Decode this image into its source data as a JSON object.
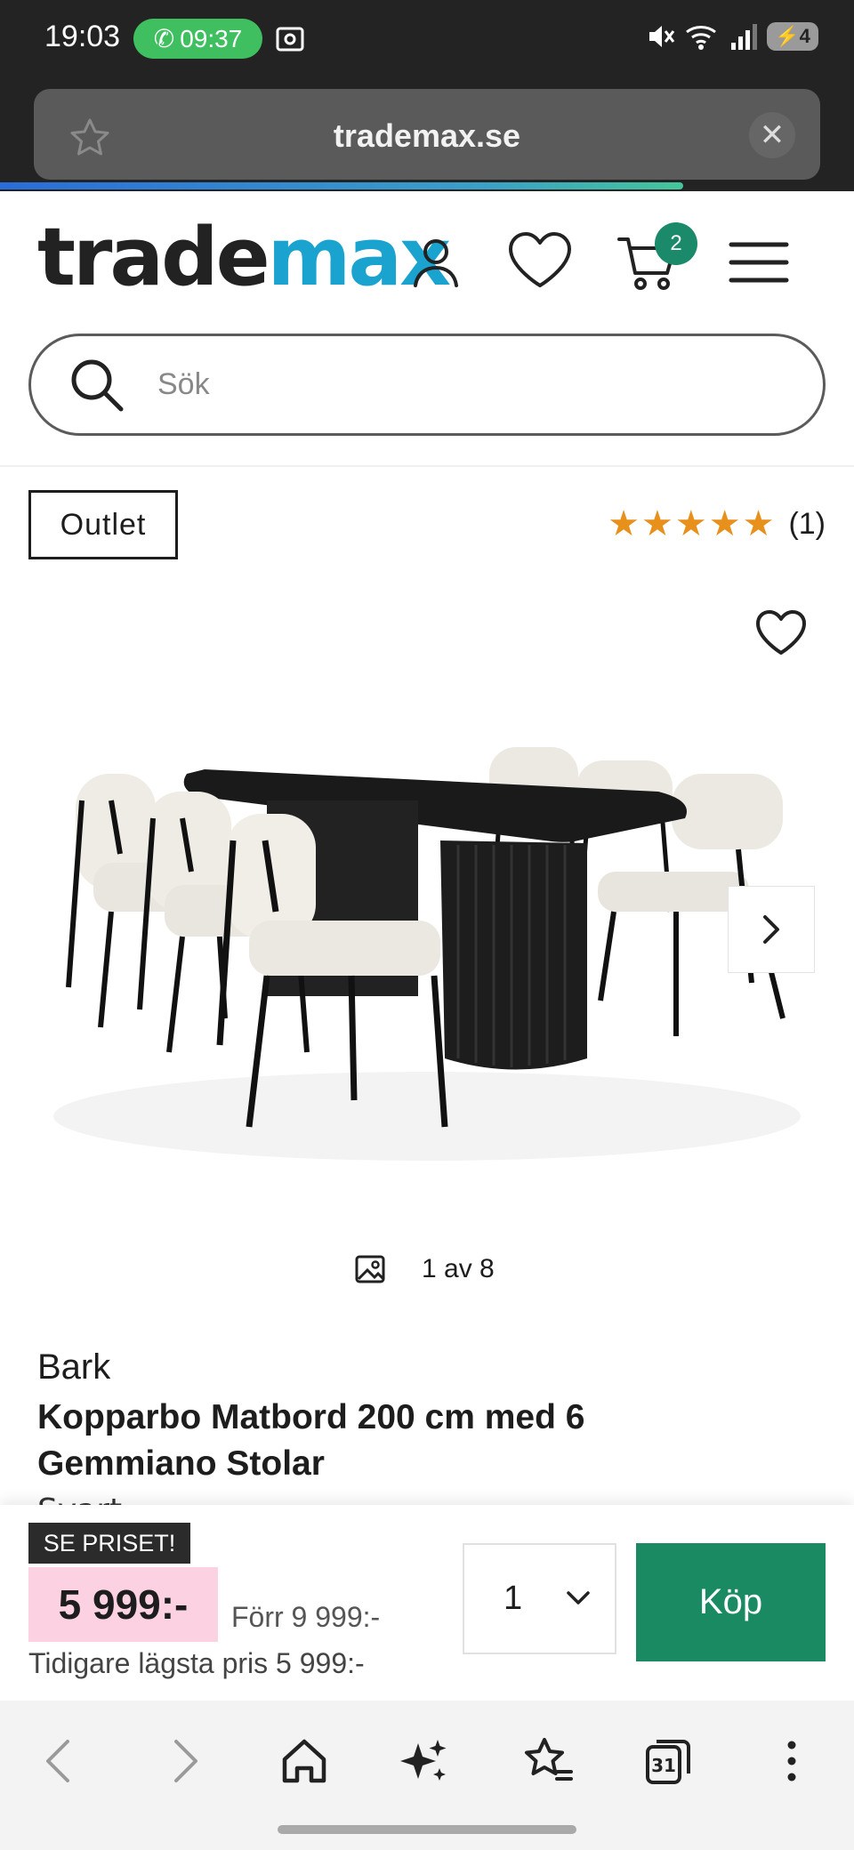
{
  "status_bar": {
    "time": "19:03",
    "call_time": "09:37",
    "battery": "4"
  },
  "browser": {
    "url": "trademax.se",
    "load_progress": 0.8
  },
  "site": {
    "logo_part1": "trade",
    "logo_part2": "max",
    "cart_count": "2",
    "search_placeholder": "Sök",
    "brand_color": "#1aa3cf"
  },
  "product": {
    "badge": "Outlet",
    "stars": "★★★★★",
    "rating_value": 5,
    "review_count": "(1)",
    "image_counter": "1 av 8",
    "brand": "Bark",
    "name": "Kopparbo Matbord 200 cm med 6 Gemmiano Stolar",
    "cutoff_text": "Svart"
  },
  "buy_bar": {
    "promo_label": "SE PRISET!",
    "price": "5 999:-",
    "before_price": "Förr 9 999:-",
    "lowest_price": "Tidigare lägsta pris 5 999:-",
    "quantity": "1",
    "buy_label": "Köp",
    "buy_color": "#1a8a62"
  },
  "icons": [
    "star-icon",
    "close-icon",
    "user-icon",
    "heart-icon",
    "cart-icon",
    "menu-icon",
    "search-icon",
    "chevron-right-icon",
    "image-icon",
    "chevron-down-icon",
    "back-icon",
    "forward-icon",
    "home-icon",
    "sparkle-icon",
    "bookmark-star-icon",
    "tabs-icon",
    "more-icon"
  ]
}
